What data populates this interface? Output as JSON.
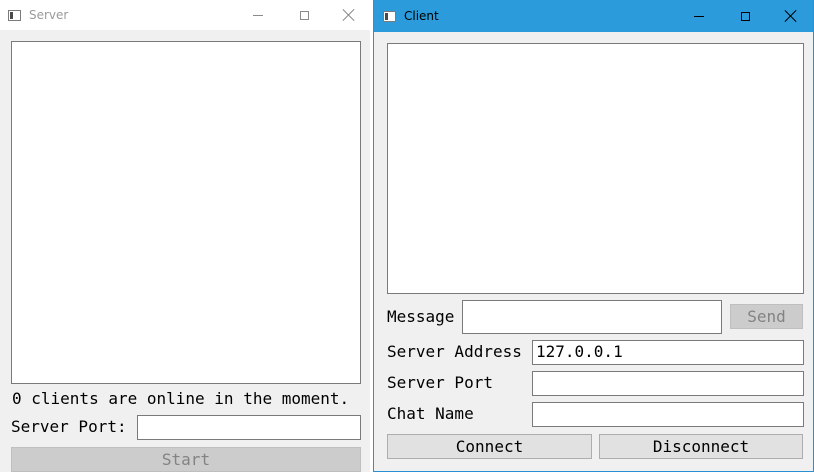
{
  "server": {
    "title": "Server",
    "status_text": "0 clients are online in the moment.",
    "port_label": "Server Port:",
    "port_value": "",
    "start_label": "Start"
  },
  "client": {
    "title": "Client",
    "message_label": "Message",
    "message_value": "",
    "send_label": "Send",
    "address_label": "Server Address",
    "address_value": "127.0.0.1",
    "port_label": "Server Port",
    "port_value": "",
    "chatname_label": "Chat Name",
    "chatname_value": "",
    "connect_label": "Connect",
    "disconnect_label": "Disconnect"
  },
  "colors": {
    "client_titlebar": "#2b9bdb",
    "window_bg": "#f0f0f0",
    "disabled_button": "#cccccc"
  },
  "icons": [
    "app-window-icon",
    "minimize-icon",
    "maximize-icon",
    "close-icon"
  ]
}
